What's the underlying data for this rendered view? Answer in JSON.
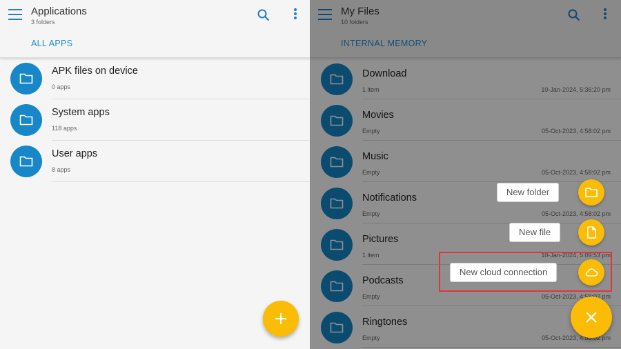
{
  "left": {
    "title": "Applications",
    "subtitle": "3 folders",
    "tab": "ALL APPS",
    "items": [
      {
        "name": "APK files on device",
        "meta": "0 apps"
      },
      {
        "name": "System apps",
        "meta": "118 apps"
      },
      {
        "name": "User apps",
        "meta": "8 apps"
      }
    ],
    "fab_icon": "plus-icon"
  },
  "right": {
    "title": "My Files",
    "subtitle": "10 folders",
    "tab": "INTERNAL MEMORY",
    "items": [
      {
        "name": "Download",
        "meta": "1 item",
        "date": "10-Jan-2024, 5:36:20 pm"
      },
      {
        "name": "Movies",
        "meta": "Empty",
        "date": "05-Oct-2023, 4:58:02 pm"
      },
      {
        "name": "Music",
        "meta": "Empty",
        "date": "05-Oct-2023, 4:58:02 pm"
      },
      {
        "name": "Notifications",
        "meta": "Empty",
        "date": "05-Oct-2023, 4:58:02 pm"
      },
      {
        "name": "Pictures",
        "meta": "1 item",
        "date": "10-Jan-2024, 5:09:53 pm"
      },
      {
        "name": "Podcasts",
        "meta": "Empty",
        "date": "05-Oct-2023, 4:58:02 pm"
      },
      {
        "name": "Ringtones",
        "meta": "Empty",
        "date": "05-Oct-2023, 4:58:02 pm"
      }
    ]
  },
  "speed_dial": {
    "new_folder": "New folder",
    "new_file": "New file",
    "new_cloud": "New cloud connection"
  },
  "colors": {
    "accent_blue": "#1787c8",
    "fab_yellow": "#fbbc05",
    "highlight_red": "#e5323b"
  }
}
